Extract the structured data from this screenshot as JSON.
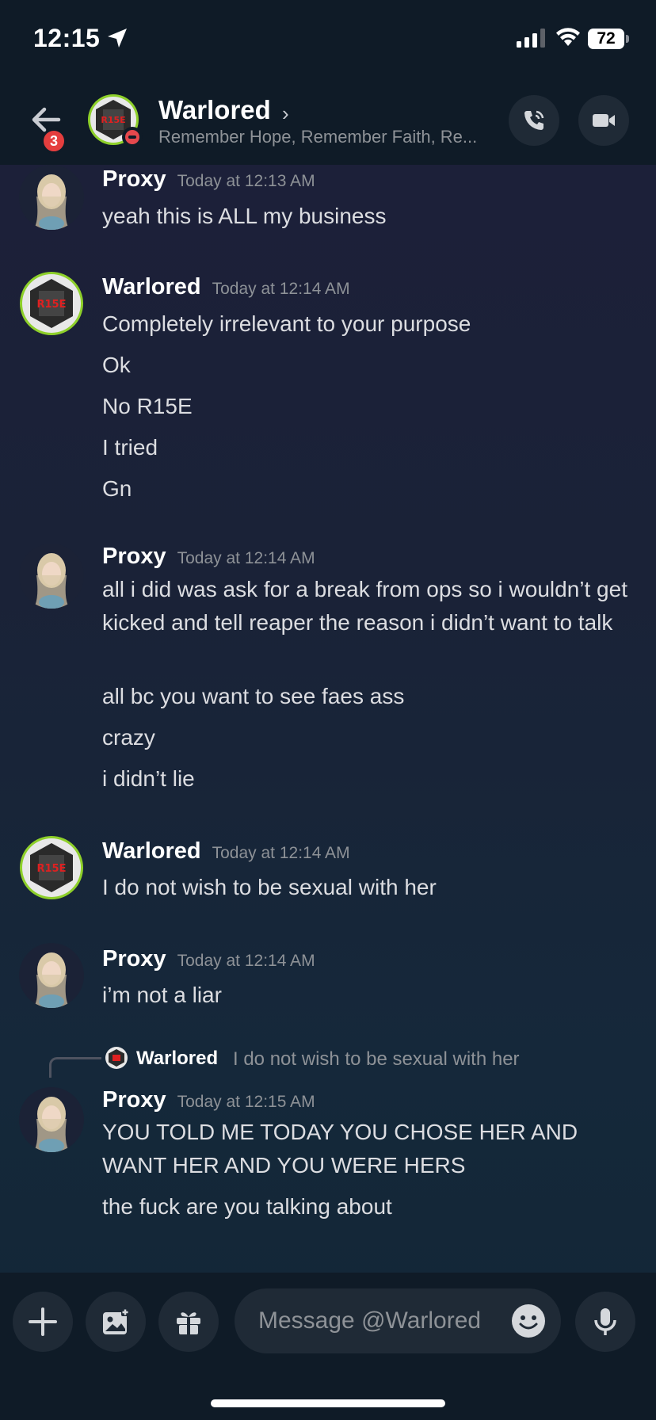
{
  "status_bar": {
    "time": "12:15",
    "battery": "72"
  },
  "header": {
    "back_badge": "3",
    "name": "Warlored",
    "status": "Remember Hope, Remember Faith, Re..."
  },
  "messages": [
    {
      "author": "Proxy",
      "timestamp": "Today at 12:13 AM",
      "avatar": "proxy-avatar",
      "lines": [
        "yeah this is ALL my business"
      ]
    },
    {
      "author": "Warlored",
      "timestamp": "Today at 12:14 AM",
      "avatar": "warlored-avatar",
      "lines": [
        "Completely irrelevant to your purpose",
        "Ok",
        "No R15E",
        "I tried",
        "Gn"
      ]
    },
    {
      "author": "Proxy",
      "timestamp": "Today at 12:14 AM",
      "avatar": "proxy-avatar",
      "lines": [
        "all i did was ask for a break from ops so i wouldn’t get kicked and tell reaper the reason i didn’t want to talk",
        "all bc you want to see faes ass",
        "crazy",
        "i didn’t lie"
      ]
    },
    {
      "author": "Warlored",
      "timestamp": "Today at 12:14 AM",
      "avatar": "warlored-avatar",
      "lines": [
        "I do not wish to be sexual with her"
      ]
    },
    {
      "author": "Proxy",
      "timestamp": "Today at 12:14 AM",
      "avatar": "proxy-avatar",
      "lines": [
        "i’m not a liar"
      ]
    },
    {
      "reply": {
        "author": "Warlored",
        "text": "I do not wish to be sexual with her"
      },
      "author": "Proxy",
      "timestamp": "Today at 12:15 AM",
      "avatar": "proxy-avatar",
      "lines": [
        "YOU TOLD ME TODAY YOU CHOSE HER AND WANT HER AND YOU WERE HERS",
        "the fuck are you talking about"
      ]
    }
  ],
  "composer": {
    "placeholder": "Message @Warlored"
  },
  "colors": {
    "dnd": "#e5484d",
    "badge": "#e53e3e",
    "avatar_ring": "#8ed02a"
  }
}
